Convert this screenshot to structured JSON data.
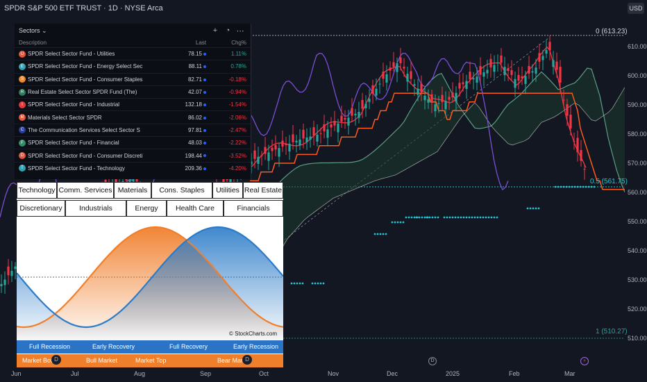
{
  "chart": {
    "symbol_title": "SPDR S&P 500 ETF TRUST · 1D · NYSE Arca",
    "currency": "USD",
    "y_axis": [
      "610.00",
      "600.00",
      "590.00",
      "580.00",
      "570.00",
      "560.00",
      "550.00",
      "540.00",
      "530.00",
      "520.00",
      "510.00"
    ],
    "x_axis": [
      "Jun",
      "Jul",
      "Aug",
      "Sep",
      "Oct",
      "Nov",
      "Dec",
      "2025",
      "Feb",
      "Mar"
    ],
    "fib_levels": [
      {
        "label": "0 (613.23)",
        "color": "#d1d4dc"
      },
      {
        "label": "0.5 (561.75)",
        "color": "#22c7d6"
      },
      {
        "label": "1 (510.27)",
        "color": "#26a69a"
      }
    ],
    "event_markers": [
      "D",
      "D",
      "D"
    ],
    "colors": {
      "up": "#26a69a",
      "down": "#f23645",
      "kijun": "#ff5a1f",
      "tenkan": "#f23645",
      "chikou": "#7b4fd6",
      "cloud_edge": "#5b9e85",
      "fib_mid": "#22c7d6"
    }
  },
  "sectors": {
    "title": "Sectors",
    "header_icons": [
      "add-icon",
      "clock-icon",
      "more-icon"
    ],
    "columns": {
      "description": "Description",
      "last": "Last",
      "chg": "Chg%"
    },
    "rows": [
      {
        "name": "SPDR Select Sector Fund - Utilities",
        "last": "78.15",
        "chg": "1.11%",
        "dir": "pos",
        "icon_color": "#e8553b",
        "glyph": "U"
      },
      {
        "name": "SPDR Select Sector Fund - Energy Select Sec",
        "last": "88.11",
        "chg": "0.78%",
        "dir": "pos",
        "icon_color": "#2ea3b8",
        "glyph": "E"
      },
      {
        "name": "SPDR Select Sector Fund - Consumer Staples",
        "last": "82.71",
        "chg": "-0.18%",
        "dir": "neg",
        "icon_color": "#f08a24",
        "glyph": "S"
      },
      {
        "name": "Real Estate Select Sector SPDR Fund (The)",
        "last": "42.07",
        "chg": "-0.94%",
        "dir": "neg",
        "icon_color": "#2f7a5a",
        "glyph": "R"
      },
      {
        "name": "SPDR Select Sector Fund - Industrial",
        "last": "132.18",
        "chg": "-1.54%",
        "dir": "neg",
        "icon_color": "#e23a3a",
        "glyph": "I"
      },
      {
        "name": "Materials Select Sector SPDR",
        "last": "86.02",
        "chg": "-2.06%",
        "dir": "neg",
        "icon_color": "#e8553b",
        "glyph": "M"
      },
      {
        "name": "The Communication Services Select Sector S",
        "last": "97.81",
        "chg": "-2.47%",
        "dir": "neg",
        "icon_color": "#2a3f9d",
        "glyph": "C"
      },
      {
        "name": "SPDR Select Sector Fund - Financial",
        "last": "48.03",
        "chg": "-2.22%",
        "dir": "neg",
        "icon_color": "#2f8f6a",
        "glyph": "F"
      },
      {
        "name": "SPDR Select Sector Fund - Consumer Discreti",
        "last": "198.44",
        "chg": "-3.52%",
        "dir": "neg",
        "icon_color": "#e8553b",
        "glyph": "D"
      },
      {
        "name": "SPDR Select Sector Fund - Technology",
        "last": "209.36",
        "chg": "-4.20%",
        "dir": "neg",
        "icon_color": "#2ea3b8",
        "glyph": "T"
      }
    ]
  },
  "rotation": {
    "tabs_top": [
      "Technology",
      "Comm. Services",
      "Materials",
      "Cons. Staples",
      "Utilities",
      "Real Estate"
    ],
    "tabs_bottom": [
      "Discretionary",
      "Industrials",
      "Energy",
      "Health Care",
      "Financials"
    ],
    "credit": "© StockCharts.com",
    "economy_phases": [
      "Full Recession",
      "Early Recovery",
      "Full Recovery",
      "Early Recession"
    ],
    "market_phases": [
      "Market Bottom",
      "Bull Market",
      "Market Top",
      "Bear Market"
    ],
    "colors": {
      "market_curve": "#f07f2c",
      "economy_curve": "#2b7bc8",
      "economy_bar": "#2b73c4",
      "market_bar": "#f07f2c"
    }
  }
}
